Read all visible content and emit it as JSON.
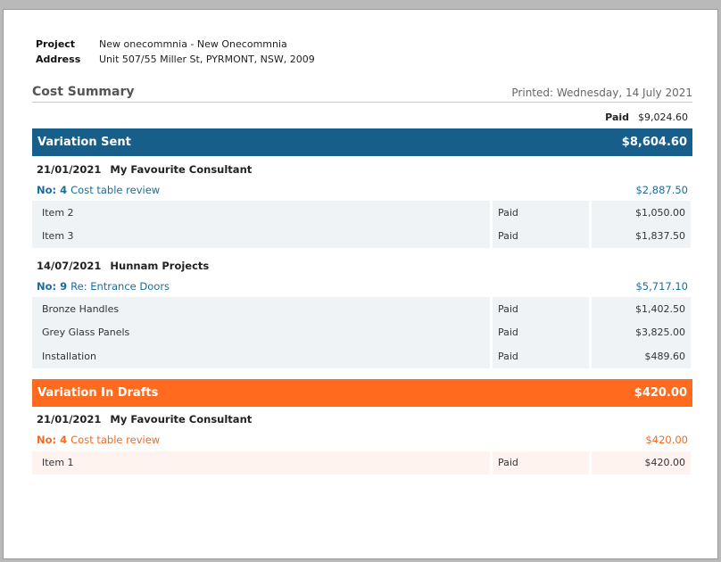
{
  "header": {
    "project_label": "Project",
    "project_value": "New onecommnia -  New Onecommnia",
    "address_label": "Address",
    "address_value": "Unit 507/55 Miller St, PYRMONT, NSW, 2009"
  },
  "summary": {
    "title": "Cost Summary",
    "printed": "Printed: Wednesday, 14 July 2021",
    "paid_label": "Paid",
    "paid_value": "$9,024.60"
  },
  "sent": {
    "title": "Variation Sent",
    "total": "$8,604.60",
    "groups": [
      {
        "date": "21/01/2021",
        "party": "My Favourite Consultant",
        "no": "No: 4",
        "desc": "Cost table review",
        "amount": "$2,887.50",
        "items": [
          {
            "name": "Item 2",
            "status": "Paid",
            "amount": "$1,050.00"
          },
          {
            "name": "Item 3",
            "status": "Paid",
            "amount": "$1,837.50"
          }
        ]
      },
      {
        "date": "14/07/2021",
        "party": "Hunnam Projects",
        "no": "No: 9",
        "desc": "Re: Entrance Doors",
        "amount": "$5,717.10",
        "items": [
          {
            "name": "Bronze Handles",
            "status": "Paid",
            "amount": "$1,402.50"
          },
          {
            "name": "Grey Glass Panels",
            "status": "Paid",
            "amount": "$3,825.00"
          },
          {
            "name": "Installation",
            "status": "Paid",
            "amount": "$489.60"
          }
        ]
      }
    ]
  },
  "drafts": {
    "title": "Variation In Drafts",
    "total": "$420.00",
    "groups": [
      {
        "date": "21/01/2021",
        "party": "My Favourite Consultant",
        "no": "No: 4",
        "desc": "Cost table review",
        "amount": "$420.00",
        "items": [
          {
            "name": "Item 1",
            "status": "Paid",
            "amount": "$420.00"
          }
        ]
      }
    ]
  },
  "colors": {
    "sent_band": "#175e8a",
    "drafts_band": "#ff6a1f"
  }
}
